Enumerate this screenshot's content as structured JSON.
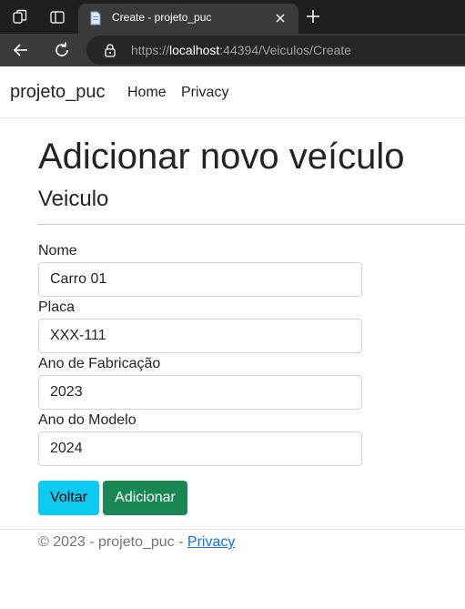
{
  "browser": {
    "tab_title": "Create - projeto_puc",
    "url_scheme": "https://",
    "url_host": "localhost",
    "url_rest": ":44394/Veiculos/Create",
    "icons": [
      "workspaces-icon",
      "tab-actions-icon",
      "page-favicon-icon",
      "close-tab-icon",
      "new-tab-icon",
      "back-icon",
      "reload-icon",
      "lock-icon"
    ]
  },
  "navbar": {
    "brand": "projeto_puc",
    "links": [
      "Home",
      "Privacy"
    ]
  },
  "main": {
    "title": "Adicionar novo veículo",
    "subtitle": "Veiculo",
    "fields": [
      {
        "label": "Nome",
        "value": "Carro 01"
      },
      {
        "label": "Placa",
        "value": "XXX-111"
      },
      {
        "label": "Ano de Fabricação",
        "value": "2023"
      },
      {
        "label": "Ano do Modelo",
        "value": "2024"
      }
    ],
    "back_button": "Voltar",
    "add_button": "Adicionar"
  },
  "footer": {
    "text": "© 2023 - projeto_puc - ",
    "link": "Privacy"
  },
  "colors": {
    "info_button": "#0dcaf0",
    "success_button": "#198754",
    "link": "#0d6efd",
    "browser_chrome": "#1f1f1f"
  }
}
